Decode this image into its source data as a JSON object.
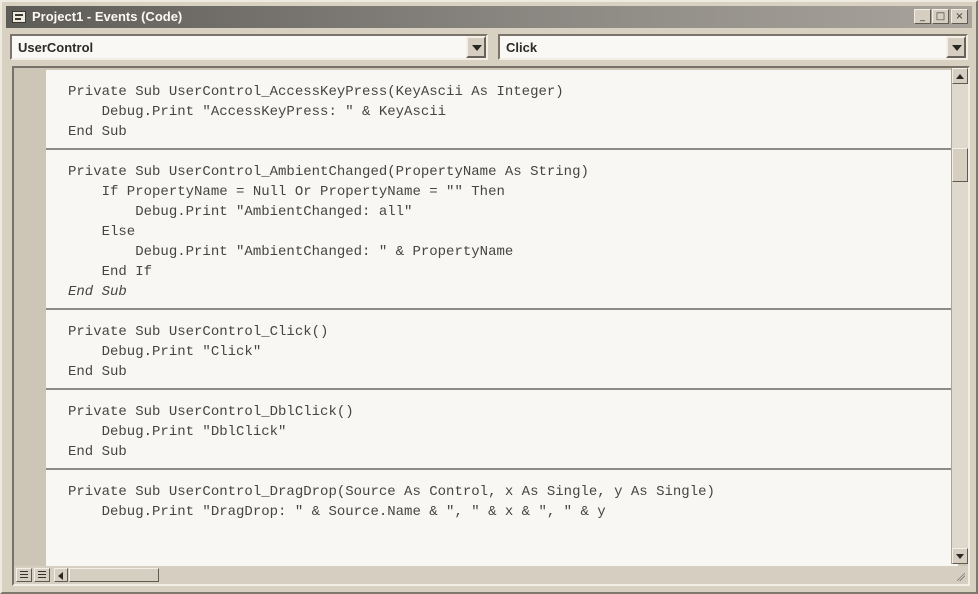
{
  "window": {
    "title": "Project1 - Events (Code)",
    "controls": {
      "minimize": "_",
      "maximize": "□",
      "close": "×"
    }
  },
  "header": {
    "object_combo": "UserControl",
    "procedure_combo": "Click"
  },
  "code": {
    "procedures": [
      {
        "lines": [
          {
            "text": "Private Sub UserControl_AccessKeyPress(KeyAscii As Integer)",
            "style": "normal"
          },
          {
            "text": "    Debug.Print \"AccessKeyPress: \" & KeyAscii",
            "style": "normal"
          },
          {
            "text": "End Sub",
            "style": "normal"
          }
        ]
      },
      {
        "lines": [
          {
            "text": "Private Sub UserControl_AmbientChanged(PropertyName As String)",
            "style": "normal"
          },
          {
            "text": "    If PropertyName = Null Or PropertyName = \"\" Then",
            "style": "normal"
          },
          {
            "text": "        Debug.Print \"AmbientChanged: all\"",
            "style": "normal"
          },
          {
            "text": "    Else",
            "style": "normal"
          },
          {
            "text": "        Debug.Print \"AmbientChanged: \" & PropertyName",
            "style": "normal"
          },
          {
            "text": "    End If",
            "style": "normal"
          },
          {
            "text": "End Sub",
            "style": "italic"
          }
        ]
      },
      {
        "lines": [
          {
            "text": "Private Sub UserControl_Click()",
            "style": "normal"
          },
          {
            "text": "    Debug.Print \"Click\"",
            "style": "normal"
          },
          {
            "text": "End Sub",
            "style": "normal"
          }
        ]
      },
      {
        "lines": [
          {
            "text": "Private Sub UserControl_DblClick()",
            "style": "normal"
          },
          {
            "text": "    Debug.Print \"DblClick\"",
            "style": "normal"
          },
          {
            "text": "End Sub",
            "style": "normal"
          }
        ]
      },
      {
        "lines": [
          {
            "text": "Private Sub UserControl_DragDrop(Source As Control, x As Single, y As Single)",
            "style": "normal"
          },
          {
            "text": "    Debug.Print \"DragDrop: \" & Source.Name & \", \" & x & \", \" & y",
            "style": "normal"
          }
        ]
      }
    ]
  }
}
